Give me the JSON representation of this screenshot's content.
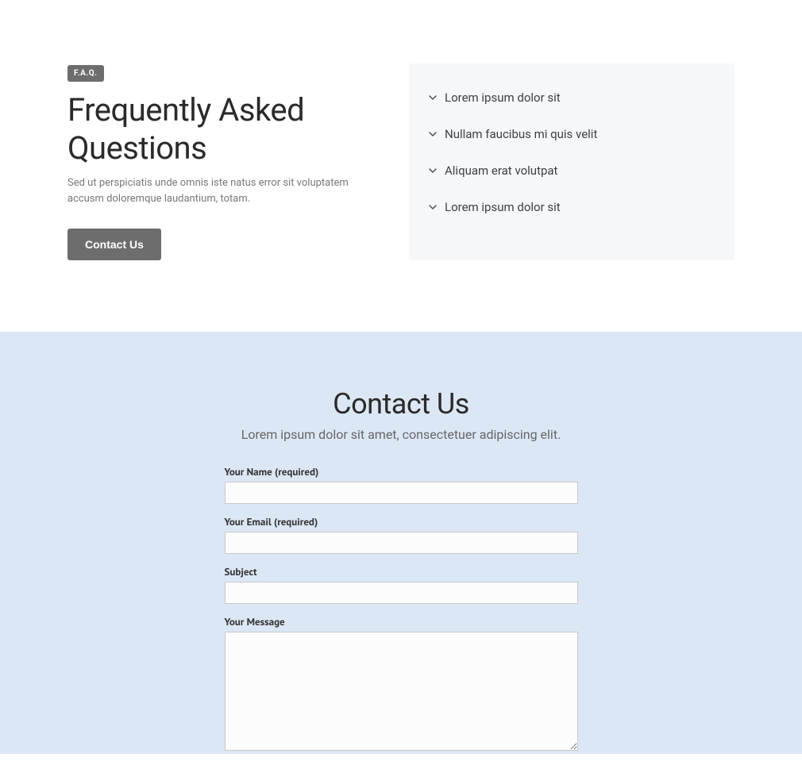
{
  "faq": {
    "badge": "F.A.Q.",
    "title": "Frequently Asked Questions",
    "subtitle": "Sed ut perspiciatis unde omnis iste natus error sit voluptatem accusm doloremque laudantium, totam.",
    "cta": "Contact Us",
    "items": [
      {
        "label": "Lorem ipsum dolor sit"
      },
      {
        "label": "Nullam faucibus mi quis velit"
      },
      {
        "label": "Aliquam erat volutpat"
      },
      {
        "label": "Lorem ipsum dolor sit"
      }
    ]
  },
  "contact": {
    "title": "Contact Us",
    "subtitle": "Lorem ipsum dolor sit amet, consectetuer adipiscing elit.",
    "fields": {
      "name_label": "Your Name (required)",
      "email_label": "Your Email (required)",
      "subject_label": "Subject",
      "message_label": "Your Message"
    }
  }
}
